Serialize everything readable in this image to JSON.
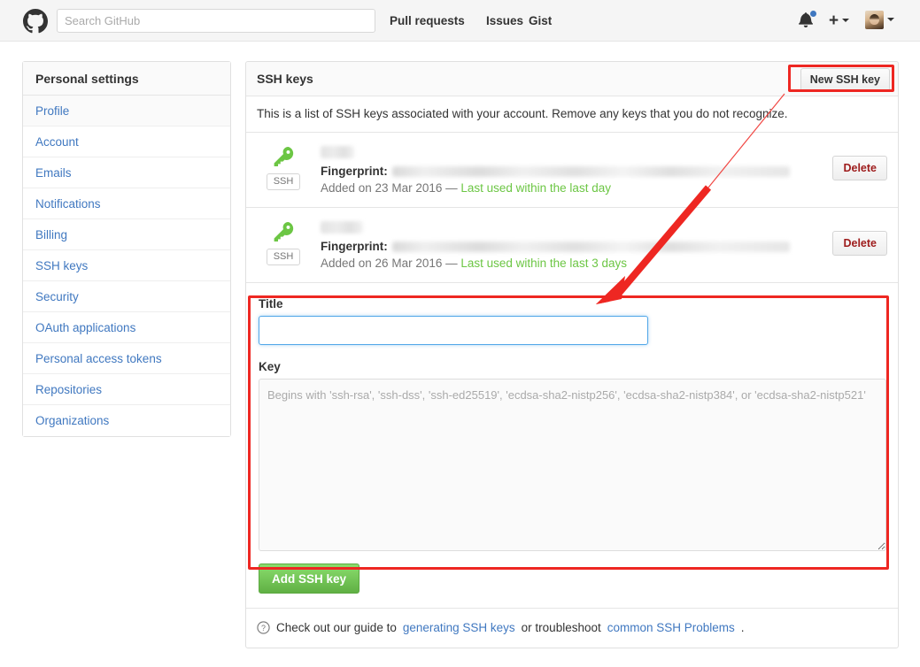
{
  "header": {
    "logo_icon": "github-mark-icon",
    "search": {
      "placeholder": "Search GitHub",
      "value": ""
    },
    "nav": [
      {
        "id": "pull-requests",
        "label": "Pull requests"
      },
      {
        "id": "issues",
        "label": "Issues"
      },
      {
        "id": "gist",
        "label": "Gist"
      }
    ],
    "notifications_icon": "bell-icon",
    "create_new_icon": "plus-icon",
    "avatar_icon": "avatar",
    "dropdown_icon": "chevron-down-icon"
  },
  "sidebar": {
    "title": "Personal settings",
    "items": [
      {
        "label": "Profile",
        "selected": true
      },
      {
        "label": "Account",
        "selected": false
      },
      {
        "label": "Emails",
        "selected": false
      },
      {
        "label": "Notifications",
        "selected": false
      },
      {
        "label": "Billing",
        "selected": false
      },
      {
        "label": "SSH keys",
        "selected": false
      },
      {
        "label": "Security",
        "selected": false
      },
      {
        "label": "OAuth applications",
        "selected": false
      },
      {
        "label": "Personal access tokens",
        "selected": false
      },
      {
        "label": "Repositories",
        "selected": false
      },
      {
        "label": "Organizations",
        "selected": false
      }
    ]
  },
  "main": {
    "title": "SSH keys",
    "new_key_button": "New SSH key",
    "description": "This is a list of SSH keys associated with your account. Remove any keys that you do not recognize.",
    "keys": [
      {
        "icon": "key-icon",
        "badge": "SSH",
        "title": "",
        "fingerprint_label": "Fingerprint:",
        "fingerprint_value": "",
        "added": "Added on 23 Mar 2016 — ",
        "last_used": "Last used within the last day",
        "delete_label": "Delete"
      },
      {
        "icon": "key-icon",
        "badge": "SSH",
        "title": "",
        "fingerprint_label": "Fingerprint:",
        "fingerprint_value": "",
        "added": "Added on 26 Mar 2016 — ",
        "last_used": "Last used within the last 3 days",
        "delete_label": "Delete"
      }
    ],
    "form": {
      "title_label": "Title",
      "title_value": "",
      "title_placeholder": "",
      "key_label": "Key",
      "key_value": "",
      "key_placeholder": "Begins with 'ssh-rsa', 'ssh-dss', 'ssh-ed25519', 'ecdsa-sha2-nistp256', 'ecdsa-sha2-nistp384', or 'ecdsa-sha2-nistp521'",
      "submit_label": "Add SSH key"
    },
    "help": {
      "icon": "question-circle-icon",
      "text_before": "Check out our guide to",
      "link1": "generating SSH keys",
      "text_middle": "or troubleshoot",
      "link2": "common SSH Problems",
      "text_after": "."
    }
  },
  "annotations": {
    "accent_color": "#ee2722",
    "highlight_button": "New SSH key",
    "highlight_form": "new key form",
    "arrow": "points from New SSH key button to the new key form"
  },
  "colors": {
    "link": "#4078c0",
    "green": "#6cc644",
    "button_green": "#60b044",
    "delete_red": "#9e1c1c",
    "annotation_red": "#ee2722",
    "focus_blue": "#51a7e8"
  }
}
